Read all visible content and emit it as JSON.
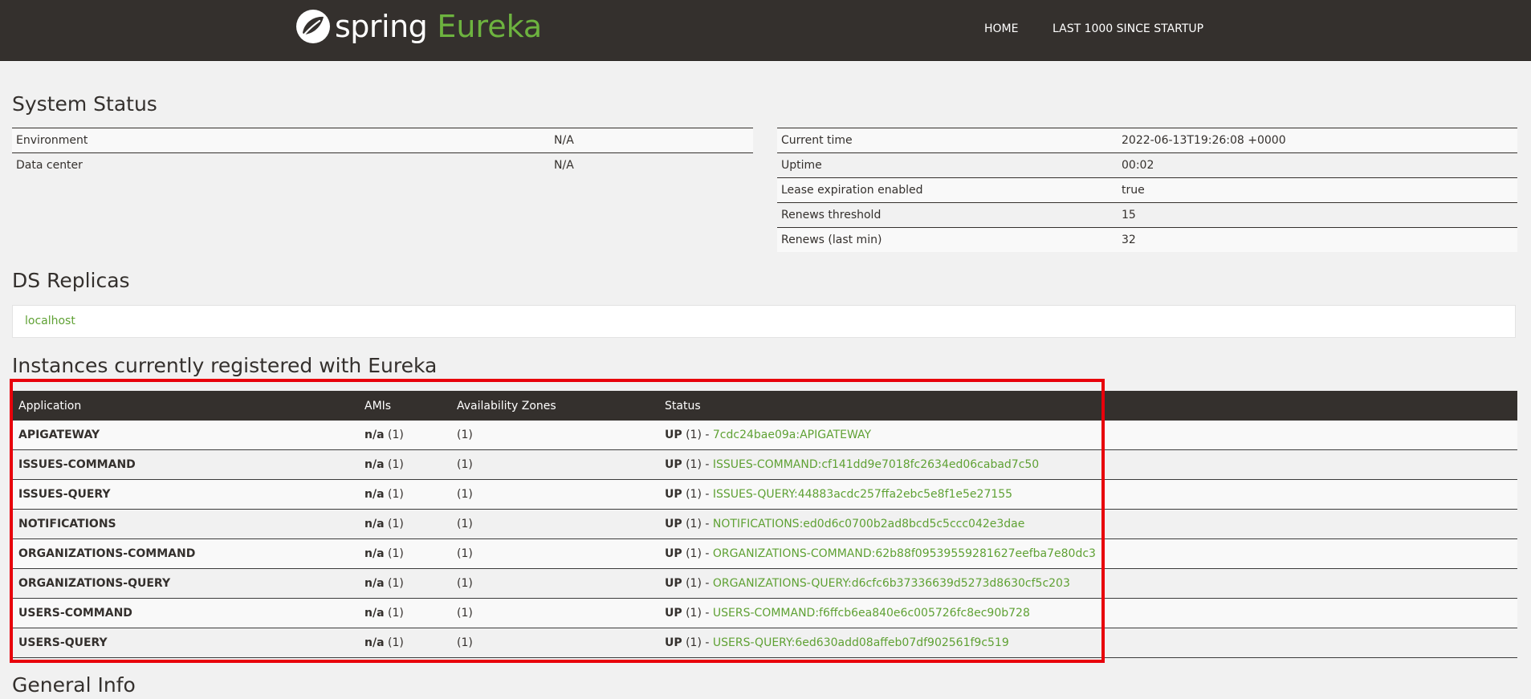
{
  "brand": {
    "spring": "spring",
    "eureka": "Eureka"
  },
  "nav": {
    "home": "HOME",
    "last1000": "LAST 1000 SINCE STARTUP"
  },
  "system_status": {
    "title": "System Status",
    "left_rows": [
      {
        "label": "Environment",
        "value": "N/A"
      },
      {
        "label": "Data center",
        "value": "N/A"
      }
    ],
    "right_rows": [
      {
        "label": "Current time",
        "value": "2022-06-13T19:26:08 +0000"
      },
      {
        "label": "Uptime",
        "value": "00:02"
      },
      {
        "label": "Lease expiration enabled",
        "value": "true"
      },
      {
        "label": "Renews threshold",
        "value": "15"
      },
      {
        "label": "Renews (last min)",
        "value": "32"
      }
    ]
  },
  "ds_replicas": {
    "title": "DS Replicas",
    "items": [
      "localhost"
    ]
  },
  "instances": {
    "title": "Instances currently registered with Eureka",
    "headers": [
      "Application",
      "AMIs",
      "Availability Zones",
      "Status"
    ],
    "rows": [
      {
        "app": "APIGATEWAY",
        "ami": "n/a",
        "ami_count": "(1)",
        "zones": "(1)",
        "status": "UP",
        "status_count": "(1) -",
        "instance": "7cdc24bae09a:APIGATEWAY"
      },
      {
        "app": "ISSUES-COMMAND",
        "ami": "n/a",
        "ami_count": "(1)",
        "zones": "(1)",
        "status": "UP",
        "status_count": "(1) -",
        "instance": "ISSUES-COMMAND:cf141dd9e7018fc2634ed06cabad7c50"
      },
      {
        "app": "ISSUES-QUERY",
        "ami": "n/a",
        "ami_count": "(1)",
        "zones": "(1)",
        "status": "UP",
        "status_count": "(1) -",
        "instance": "ISSUES-QUERY:44883acdc257ffa2ebc5e8f1e5e27155"
      },
      {
        "app": "NOTIFICATIONS",
        "ami": "n/a",
        "ami_count": "(1)",
        "zones": "(1)",
        "status": "UP",
        "status_count": "(1) -",
        "instance": "NOTIFICATIONS:ed0d6c0700b2ad8bcd5c5ccc042e3dae"
      },
      {
        "app": "ORGANIZATIONS-COMMAND",
        "ami": "n/a",
        "ami_count": "(1)",
        "zones": "(1)",
        "status": "UP",
        "status_count": "(1) -",
        "instance": "ORGANIZATIONS-COMMAND:62b88f09539559281627eefba7e80dc3"
      },
      {
        "app": "ORGANIZATIONS-QUERY",
        "ami": "n/a",
        "ami_count": "(1)",
        "zones": "(1)",
        "status": "UP",
        "status_count": "(1) -",
        "instance": "ORGANIZATIONS-QUERY:d6cfc6b37336639d5273d8630cf5c203"
      },
      {
        "app": "USERS-COMMAND",
        "ami": "n/a",
        "ami_count": "(1)",
        "zones": "(1)",
        "status": "UP",
        "status_count": "(1) -",
        "instance": "USERS-COMMAND:f6ffcb6ea840e6c005726fc8ec90b728"
      },
      {
        "app": "USERS-QUERY",
        "ami": "n/a",
        "ami_count": "(1)",
        "zones": "(1)",
        "status": "UP",
        "status_count": "(1) -",
        "instance": "USERS-QUERY:6ed630add08affeb07df902561f9c519"
      }
    ]
  },
  "general_info": {
    "title": "General Info"
  },
  "colors": {
    "navbar": "#34302d",
    "accent_green": "#6db33f",
    "link_green": "#5fa134",
    "highlight_red": "#e8000b"
  }
}
